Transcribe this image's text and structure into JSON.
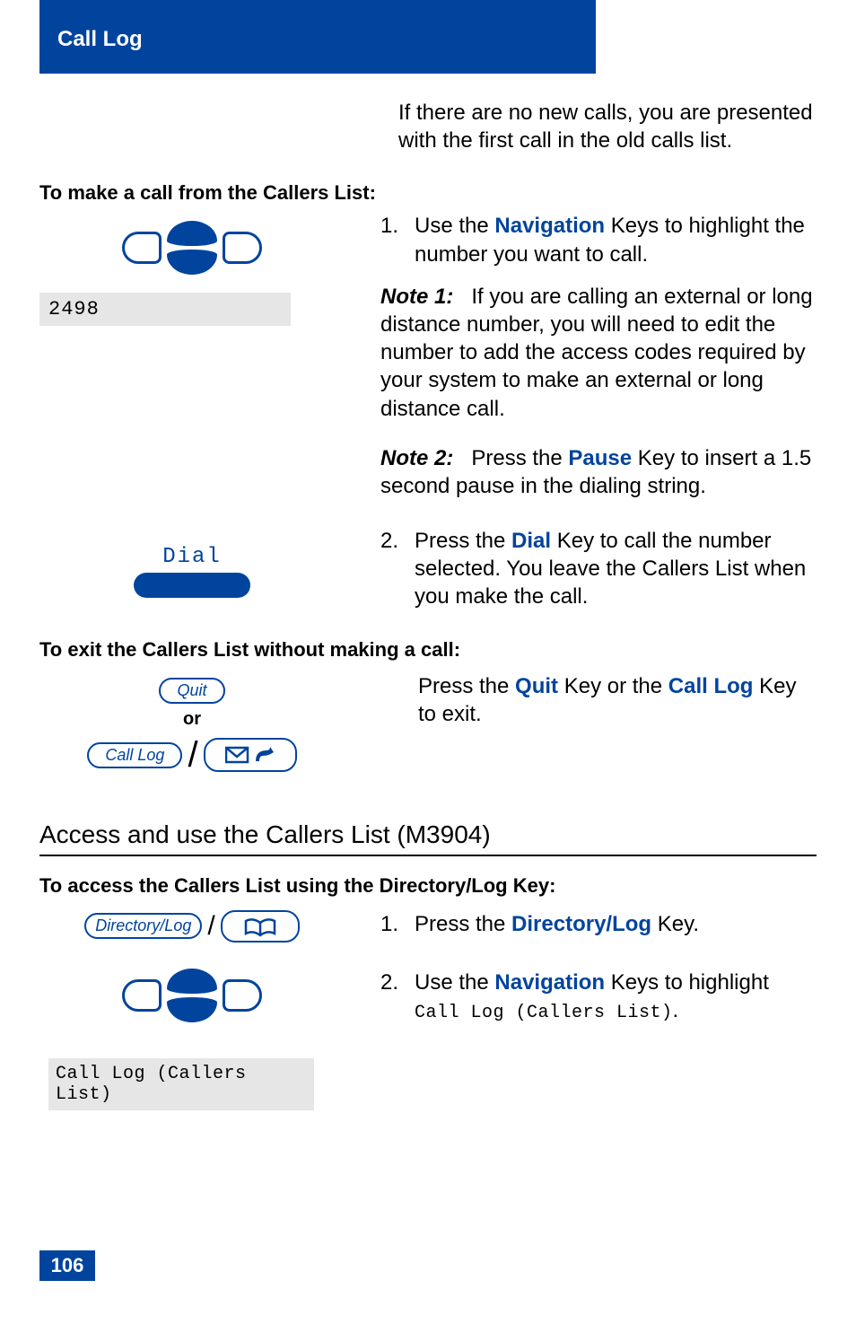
{
  "header": {
    "title": "Call Log"
  },
  "pageNumber": "106",
  "intro": "If there are no new calls, you are presented with the first call in the old calls list.",
  "heading_make": "To make a call from the Callers List:",
  "lcd_number": "2498",
  "step1": {
    "num": "1.",
    "pre": "Use the ",
    "key": "Navigation",
    "post": " Keys to highlight the number you want to call."
  },
  "note1": {
    "label": "Note 1:",
    "text": "If you are calling an external or long distance number, you will need to edit the number to add the access codes required by your system to make an external or long distance call."
  },
  "note2": {
    "label": "Note 2:",
    "pre": "Press the ",
    "key": "Pause",
    "post": " Key to insert a 1.5 second pause in the dialing string."
  },
  "dial_label": "Dial",
  "step2": {
    "num": "2.",
    "pre": "Press the ",
    "key": "Dial",
    "post": " Key to call the number selected. You leave the Callers List when you make the call."
  },
  "heading_exit": "To exit the Callers List without making a call:",
  "quit_key": "Quit",
  "or_label": "or",
  "calllog_key": "Call Log",
  "exit_text": {
    "pre": "Press  the ",
    "key1": "Quit",
    "mid": " Key or the ",
    "key2": "Call Log",
    "post": " Key to exit."
  },
  "section_title": "Access and use the Callers List (M3904)",
  "heading_access": "To access the Callers List using the Directory/Log Key:",
  "dirlog_key": "Directory/Log",
  "access_step1": {
    "num": "1.",
    "pre": "Press the ",
    "key": "Directory/Log",
    "post": " Key."
  },
  "access_step2": {
    "num": "2.",
    "pre": "Use the ",
    "key": "Navigation",
    "post": " Keys to highlight ",
    "lcd": "Call Log (Callers List)",
    "period": "."
  },
  "lcd_calllog": "Call Log (Callers List)"
}
